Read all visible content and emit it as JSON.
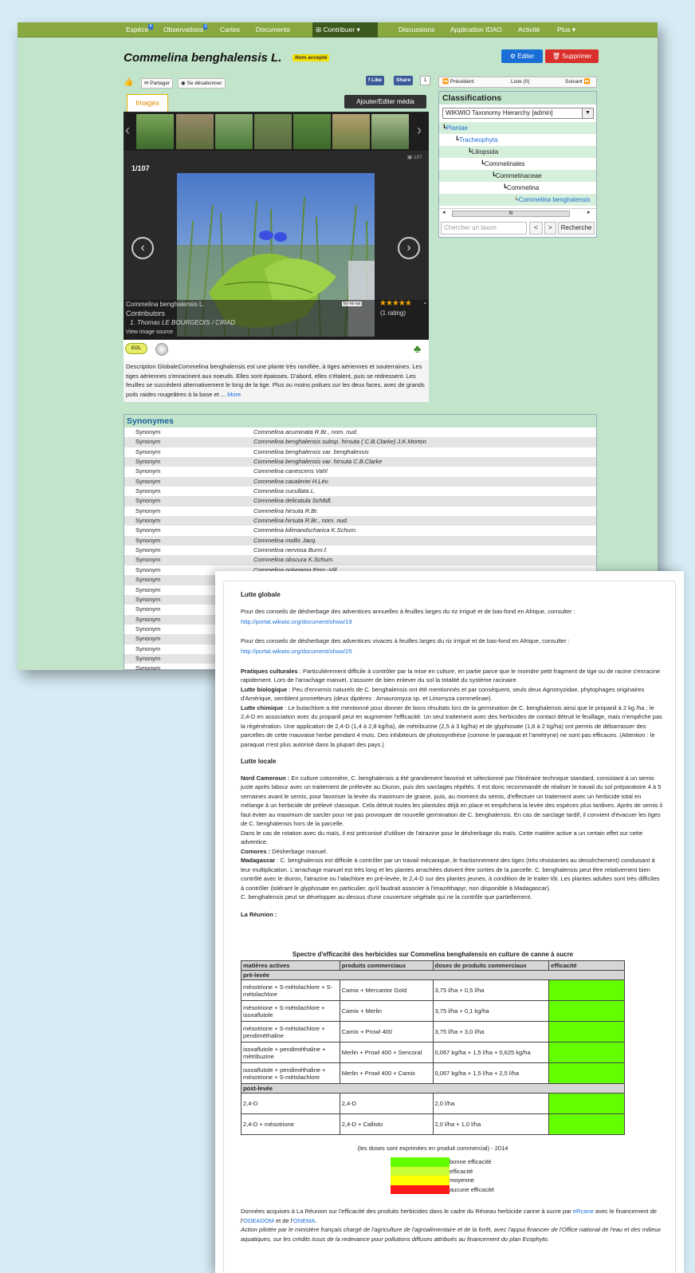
{
  "nav": {
    "items": [
      {
        "label": "Espèce",
        "badge": "4"
      },
      {
        "label": "Observations",
        "badge": "3"
      },
      {
        "label": "Cartes",
        "badge": ""
      },
      {
        "label": "Documents",
        "badge": ""
      },
      {
        "label": "Contribuer",
        "badge": ""
      },
      {
        "label": "Discussions",
        "badge": ""
      },
      {
        "label": "Application IDAO",
        "badge": ""
      },
      {
        "label": "Activité",
        "badge": ""
      },
      {
        "label": "Plus",
        "badge": ""
      }
    ]
  },
  "page": {
    "title": "Commelina benghalensis  L.",
    "status_badge": "Nom accepté",
    "edit_label": "Editer",
    "delete_label": "Supprimer",
    "share_label": "Partager",
    "unsubscribe_label": "Se désabonner",
    "fb_like": "Like",
    "fb_share": "Share",
    "share_count": "1"
  },
  "gallery": {
    "tab": "Images",
    "add_media": "Ajouter/Editer média",
    "counter": "1/107",
    "image_count": "107",
    "species": "Commelina benghalensis L.",
    "contributors_label": "Contributors",
    "contributor": "1. Thomas LE BOURGEOIS / CIRAD",
    "view_source": "View image source",
    "license": "by-nc-sa",
    "stars": "★★★★★",
    "rating": "(1 rating)"
  },
  "description": {
    "text": "Description GlobaleCommelina benghalensis est une plante très ramifiée, à tiges aériennes et souterraines. Les tiges aériennes s'enracinent aux noeuds. Elles sont épaisses. D'abord, elles s'étalent, puis se redressent. Les feuilles se succèdent alternativement le long de la tige. Plus ou moins poilues sur les deux faces, avec de grands poils raides rougeâtres à la base et ...",
    "more": "More"
  },
  "pager": {
    "prev": "Précédent",
    "list": "Liste (0)",
    "next": "Suivant"
  },
  "classification": {
    "title": "Classifications",
    "hierarchy": "WIKWIO Taxonomy Hierarchy [admin]",
    "tree": [
      {
        "label": "Plantae",
        "link": true
      },
      {
        "label": "Tracheophyta",
        "link": true
      },
      {
        "label": "Liliopsida",
        "link": false
      },
      {
        "label": "Commelinales",
        "link": false
      },
      {
        "label": "Commelinaceae",
        "link": false
      },
      {
        "label": "Commelina",
        "link": false
      },
      {
        "label": "Commelina benghalensis",
        "link": true
      }
    ],
    "search_placeholder": "Chercher un taxon",
    "btn_prev": "<",
    "btn_next": ">",
    "btn_search": "Recherche",
    "scroll_label": "III"
  },
  "synonyms": {
    "title": "Synonymes",
    "rows": [
      {
        "type": "Synonym",
        "name": "Commelina acuminata  R.Br., nom. nud."
      },
      {
        "type": "Synonym",
        "name": "Commelina benghalensis  subsp. hirsuta  ( C.B.Clarke)  J.K.Morton"
      },
      {
        "type": "Synonym",
        "name": "Commelina benghalensis  var. benghalensis"
      },
      {
        "type": "Synonym",
        "name": "Commelina benghalensis  var. hirsuta  C.B.Clarke"
      },
      {
        "type": "Synonym",
        "name": "Commelina canescens  Vahl"
      },
      {
        "type": "Synonym",
        "name": "Commelina cavaleriei  H.Lév."
      },
      {
        "type": "Synonym",
        "name": "Commelina cucullata  L."
      },
      {
        "type": "Synonym",
        "name": "Commelina delicatula  Schltdl."
      },
      {
        "type": "Synonym",
        "name": "Commelina hirsuta  R.Br."
      },
      {
        "type": "Synonym",
        "name": "Commelina hirsuta  R.Br., nom. nud."
      },
      {
        "type": "Synonym",
        "name": "Commelina kilimandscharica  K.Schum."
      },
      {
        "type": "Synonym",
        "name": "Commelina mollis  Jacq."
      },
      {
        "type": "Synonym",
        "name": "Commelina nervosa  Burm.f."
      },
      {
        "type": "Synonym",
        "name": "Commelina obscura  K.Schum."
      },
      {
        "type": "Synonym",
        "name": "Commelina polygama  Fern.-Vill."
      },
      {
        "type": "Synonym",
        "name": ""
      },
      {
        "type": "Synonym",
        "name": ""
      },
      {
        "type": "Synonym",
        "name": ""
      },
      {
        "type": "Synonym",
        "name": ""
      },
      {
        "type": "Synonym",
        "name": ""
      },
      {
        "type": "Synonym",
        "name": ""
      },
      {
        "type": "Synonym",
        "name": ""
      },
      {
        "type": "Synonym",
        "name": ""
      },
      {
        "type": "Synonym",
        "name": ""
      },
      {
        "type": "Synonym",
        "name": ""
      }
    ]
  },
  "doc": {
    "h_globale": "Lutte globale",
    "p1": "Pour des conseils de désherbage des adventices annuelles à feuilles larges du riz irrigué et de bas-fond en Afrique, consulter :",
    "l1": "http://portal.wikwio.org/document/show/19",
    "p2": "Pour des conseils de désherbage des adventices vivaces à feuilles larges du riz irrigué et de bas-fond en Afrique, consulter :",
    "l2": "http://portal.wikwio.org/document/show/25",
    "pc_b": "Pratiques culturales",
    "pc": " : Particulièrement difficile à contrôler par la mise en culture, en partie parce que le moindre petit fragment de tige ou de racine s'enracine rapidement. Lors de l'arrachage manuel, s'assurer de bien enlever du sol la totalité du système racinaire.",
    "lb_b": "Lutte biologique",
    "lb": " : Peu d'ennemis naturels de C. benghalensis ont été mentionnés et par conséquent, seuls deux Agromyzidae, phytophages originaires d'Amérique, semblent prometteurs (deux diptères : Amauromyza sp. et Liriomyza commelinae).",
    "lc_b": "Lutte chimique",
    "lc": " : Le butachlore a été mentionné pour donner de bons résultats lors de la germination de C. benghalensis ainsi que le propanil à 2 kg /ha ; le 2,4-D en association avec du propanil peut en augmenter l'efficacité. Un seul traitement avec des herbicides de contact détruit le feuillage, mais n'empêche pas la régénération. Une application de 2,4-D (1,4 à 2,8 kg/ha), de métribuzine (2,5 à 3 kg/ha) et de glyphosate (1,8 à 2 kg/ha) ont permis de débarrasser des parcelles de cette mauvaise herbe pendant 4 mois. Des inhibiteurs de photosynthèse (comme le paraquat et l'amétryne) ne sont pas efficaces. (Attention : le paraquat n'est plus autorisé dans la plupart des pays.)",
    "h_locale": "Lutte locale",
    "nc_b": "Nord Cameroun :",
    "nc": " En culture cotonnière, C. benghalensis a été grandement favorisé et sélectionné par l'itinéraire technique standard, consistant à un semis juste après labour avec un traitement de prélevée au Diuron, puis des sarclages répétés. Il est donc recommandé de réaliser le travail du sol préparatoire 4 à 5 semaines avant le semis, pour favoriser la levée du maximum de graine, puis, au moment du semis, d'effectuer un traitement avec un herbicide total en mélange à un herbicide de prélevé classique. Cela détruit toutes les plantules déjà en place et empêchera la levée des espèces plus tardives. Après de semis il faut éviter au maximum de sarcler pour ne pas provoquer de nouvelle germination de C. benghalensis. En cas de sarclage tardif, il convient d'évacuer les tiges de C. benghalensis hors de la parcelle.",
    "nc2": "Dans le cas de rotation avec du maïs, il est préconisé d'utiliser de l'atrazine pour le désherbage du maïs. Cette matière active a un certain effet sur cette adventice.",
    "co_b": "Comores :",
    "co": " Désherbage manuel.",
    "ma_b": "Madagascar",
    "ma": " : C. benghalensis est difficile à contrôler par un travail mécanique, le fractionnement des tiges (très résistantes au dessèchement) conduisant à leur multiplication. L'arrachage manuel est très long et les plantes arrachées doivent être sorties de la parcelle. C. benghalensis peut être relativement bien contrôlé avec le diuron, l'atrazine ou l'alachlore en pré-levée, le 2,4-D sur des plantes jeunes, à condition de le traiter tôt. Les plantes adultes sont très difficiles à contrôler (tolérant le glyphosate en particulier, qu'il faudrait associer à l'imazéthapyr, non disponible à Madagascar).",
    "ma2": "C. benghalensis peut se développer au-dessus d'une couverture végétale qui ne la contrôle que partiellement.",
    "re": "La Réunion :",
    "table_title": "Spectre d'efficacité des herbicides sur Commelina benghalensis en culture de canne à sucre",
    "cols": [
      "matières actives",
      "produits commerciaux",
      "doses de produits commerciaux",
      "efficacité"
    ],
    "sec1": "pré-levée",
    "sec2": "post-levée",
    "rows1": [
      {
        "ma": "mésotrione + S-métolachlore + S-métolachlore",
        "pc": "Camix + Mercantor Gold",
        "dose": "3,75 l/ha + 0,5 l/ha",
        "eff": "good"
      },
      {
        "ma": "mésotrione + S-métolachlore + isoxaflutole",
        "pc": "Camix + Merlin",
        "dose": "3,75 l/ha + 0,1 kg/ha",
        "eff": "good"
      },
      {
        "ma": "mésotrione + S-métolachlore + pendiméthaline",
        "pc": "Camix + Prowl 400",
        "dose": "3,75 l/ha + 3,0 l/ha",
        "eff": "good"
      },
      {
        "ma": "isoxaflutole + pendiméthaline + métribuzine",
        "pc": "Merlin + Prowl 400 + Sencoral",
        "dose": "0,067 kg/ha + 1,5 l/ha + 0,625 kg/ha",
        "eff": "good"
      },
      {
        "ma": "isoxaflutole + pendiméthaline + mésotrione + S-métolachlore",
        "pc": "Merlin + Prowl 400 + Camix",
        "dose": "0,067 kg/ha + 1,5 l/ha + 2,5 l/ha",
        "eff": "good"
      }
    ],
    "rows2": [
      {
        "ma": "2,4-D",
        "pc": "2,4-D",
        "dose": "2,0 l/ha",
        "eff": "good"
      },
      {
        "ma": "2,4-D + mésotrione",
        "pc": "2,4-D + Callisto",
        "dose": "2,0 l/ha + 1,0 l/ha",
        "eff": "good"
      }
    ],
    "doses_note": "(les doses sont exprimées en produit commercial) - 2014",
    "legend": [
      {
        "label": "bonne efficacité",
        "color": "#63ff00"
      },
      {
        "label": "efficacité",
        "color": "#ccff33"
      },
      {
        "label": "moyenne",
        "color": "#ffff00"
      },
      {
        "label": "aucune efficacité",
        "color": "#ff1a1a"
      }
    ],
    "fin1": "Données acquises à La Réunion sur l'efficacité des produits herbicides dans le cadre du Réseau herbicide canne à sucre par",
    "fin1_link": "eRcane",
    "fin1b": " avec le financement de l'",
    "fin_link2": "ODEADOM",
    "fin_mid": " et de l'",
    "fin_link3": "ONEMA",
    "fin2": "Action pilotée par le ministère français chargé de l'agriculture de l'agroalimentaire et de la forêt, avec l'appui financier de l'Office national de l'eau et des milieux aquatiques, sur les crédits issus de la redevance pour pollutions diffuses attribués au financement du plan Ecophyto."
  },
  "colors": {
    "nav": "#8aa842",
    "page_bg": "#c2e4ca",
    "accent": "#1a6fd6",
    "danger": "#d9302b",
    "good": "#63ff00"
  }
}
